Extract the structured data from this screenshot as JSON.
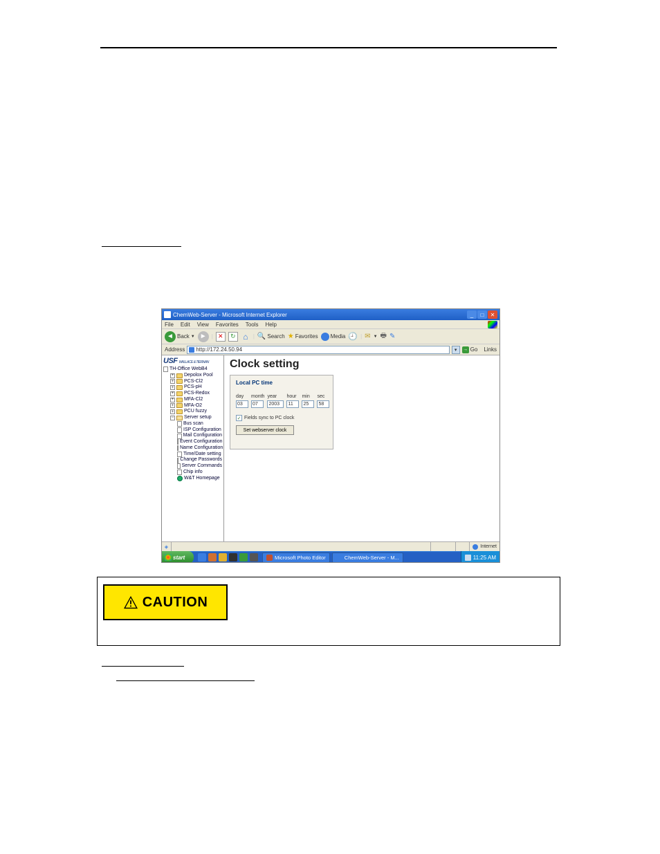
{
  "domain": "Computer-Use",
  "page_rule_top": true,
  "window": {
    "title": "ChemWeb-Server - Microsoft Internet Explorer",
    "buttons": {
      "min": "_",
      "max": "□",
      "close": "✕"
    }
  },
  "menubar": [
    "File",
    "Edit",
    "View",
    "Favorites",
    "Tools",
    "Help"
  ],
  "toolbar": {
    "back": "Back",
    "search": "Search",
    "favorites": "Favorites",
    "media": "Media"
  },
  "addressbar": {
    "label": "Address",
    "url": "http://172.24.50.94",
    "go": "Go",
    "links": "Links"
  },
  "sidebar": {
    "logo": "USF",
    "logo_sub": "WALLACE & TIERNAN",
    "root": "TH-Office WebB4",
    "items": [
      {
        "label": "Depolox Pool",
        "expand": "+"
      },
      {
        "label": "PCS-Cl2",
        "expand": "+"
      },
      {
        "label": "PCS-pH",
        "expand": "+"
      },
      {
        "label": "PCS-Redox",
        "expand": "+"
      },
      {
        "label": "MFA-Cl2",
        "expand": "+"
      },
      {
        "label": "MFA-O2",
        "expand": "+"
      },
      {
        "label": "PCU fuzzy",
        "expand": "+"
      }
    ],
    "server_setup": {
      "label": "Server setup",
      "expand": "−",
      "children": [
        "Bus scan",
        "ISP Configuration",
        "Mail Configuration",
        "Event Configuration",
        "Name Configuration",
        "Time/Date setting",
        "Change Passwords",
        "Server Commands",
        "Chip info",
        "W&T Homepage"
      ]
    }
  },
  "main": {
    "title": "Clock setting",
    "legend": "Local PC time",
    "fields": {
      "day": {
        "label": "day",
        "value": "03"
      },
      "month": {
        "label": "month",
        "value": "07"
      },
      "year": {
        "label": "year",
        "value": "2003"
      },
      "hour": {
        "label": "hour",
        "value": "11"
      },
      "min": {
        "label": "min",
        "value": "25"
      },
      "sec": {
        "label": "sec",
        "value": "58"
      }
    },
    "sync_checkbox": {
      "checked": true,
      "label": "Fields sync to PC clock"
    },
    "set_button": "Set webserver clock"
  },
  "statusbar": {
    "zone": "Internet"
  },
  "taskbar": {
    "start": "start",
    "tasks": [
      "Microsoft Photo Editor",
      "ChemWeb-Server - M..."
    ],
    "clock": "11:25 AM"
  },
  "caution": {
    "label": "CAUTION"
  }
}
